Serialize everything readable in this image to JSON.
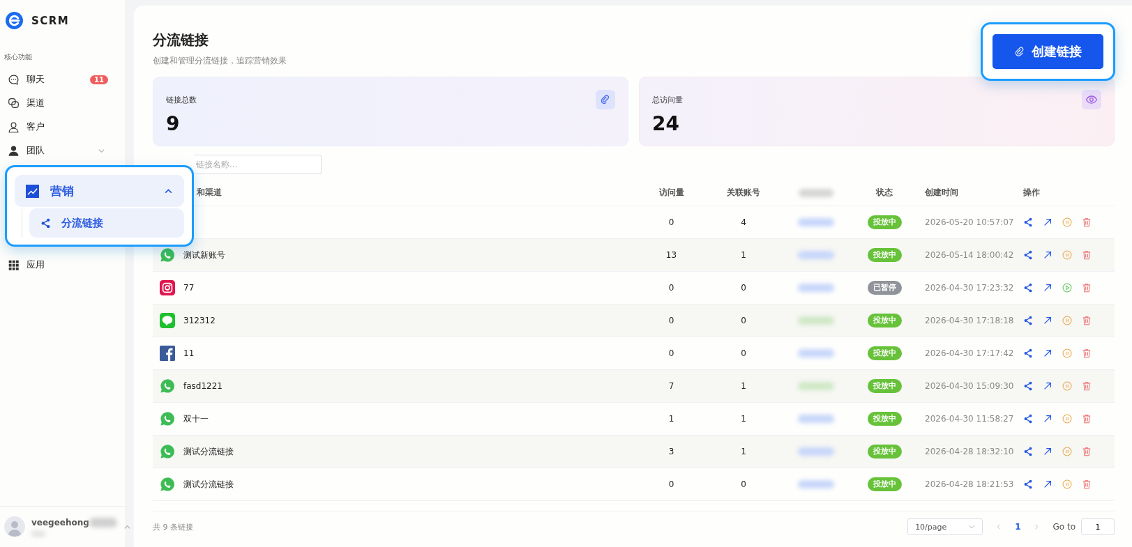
{
  "sidebar": {
    "brand": "SCRM",
    "section_label": "核心功能",
    "items": [
      {
        "label": "聊天",
        "kind": "chat",
        "badge": "11"
      },
      {
        "label": "渠道",
        "kind": "channel"
      },
      {
        "label": "客户",
        "kind": "user"
      },
      {
        "label": "团队",
        "kind": "team",
        "expanded": false
      },
      {
        "label": "应用",
        "kind": "apps"
      }
    ],
    "user": {
      "name": "veegeehong",
      "expanded": false
    }
  },
  "highlight_menu": {
    "label": "营销",
    "expanded": true,
    "children": [
      {
        "label": "分流链接",
        "selected": true
      }
    ]
  },
  "page": {
    "title": "分流链接",
    "subtitle": "创建和管理分流链接，追踪营销效果",
    "create_button": "创建链接"
  },
  "stats": [
    {
      "label": "链接总数",
      "value": "9",
      "kind": "link"
    },
    {
      "label": "总访问量",
      "value": "24",
      "kind": "views"
    }
  ],
  "search": {
    "placeholder": "链接名称..."
  },
  "table": {
    "columns": [
      "和渠道",
      "访问量",
      "关联账号",
      "状态",
      "创建时间",
      "操作"
    ],
    "rows": [
      {
        "visits": "0",
        "accounts": "4",
        "color": "#c7d6fa",
        "status": {
          "label": "投放中",
          "kind": "active"
        },
        "created": "2026-05-20 10:57:07"
      },
      {
        "kind": "whatsapp",
        "name": "测试新账号",
        "visits": "13",
        "accounts": "1",
        "color": "#c7d6fa",
        "status": {
          "label": "投放中",
          "kind": "active"
        },
        "created": "2026-05-14 18:00:42"
      },
      {
        "kind": "instagram",
        "name": "77",
        "visits": "0",
        "accounts": "0",
        "color": "#c7d6fa",
        "status": {
          "label": "已暂停",
          "kind": "paused"
        },
        "created": "2026-04-30 17:23:32"
      },
      {
        "kind": "line",
        "name": "312312",
        "visits": "0",
        "accounts": "0",
        "color": "#cfe8c6",
        "status": {
          "label": "投放中",
          "kind": "active"
        },
        "created": "2026-04-30 17:18:18"
      },
      {
        "kind": "facebook",
        "name": "11",
        "visits": "0",
        "accounts": "0",
        "color": "#c7d6fa",
        "status": {
          "label": "投放中",
          "kind": "active"
        },
        "created": "2026-04-30 17:17:42"
      },
      {
        "kind": "whatsapp",
        "name": "fasd1221",
        "visits": "7",
        "accounts": "1",
        "color": "#cfe8c6",
        "status": {
          "label": "投放中",
          "kind": "active"
        },
        "created": "2026-04-30 15:09:30"
      },
      {
        "kind": "whatsapp",
        "name": "双十一",
        "visits": "1",
        "accounts": "1",
        "color": "#c7d6fa",
        "status": {
          "label": "投放中",
          "kind": "active"
        },
        "created": "2026-04-30 11:58:27"
      },
      {
        "kind": "whatsapp",
        "name": "测试分流链接",
        "visits": "3",
        "accounts": "1",
        "color": "#c7d6fa",
        "status": {
          "label": "投放中",
          "kind": "active"
        },
        "created": "2026-04-28 18:32:10"
      },
      {
        "kind": "whatsapp",
        "name": "测试分流链接",
        "visits": "0",
        "accounts": "0",
        "color": "#c7d6fa",
        "status": {
          "label": "投放中",
          "kind": "active"
        },
        "created": "2026-04-28 18:21:53"
      }
    ]
  },
  "footer": {
    "total": "共 9 条链接",
    "page_size": "10/page",
    "pages": [
      {
        "label": "1",
        "selected": true
      }
    ],
    "goto_label": "Go to",
    "goto_value": "1"
  }
}
